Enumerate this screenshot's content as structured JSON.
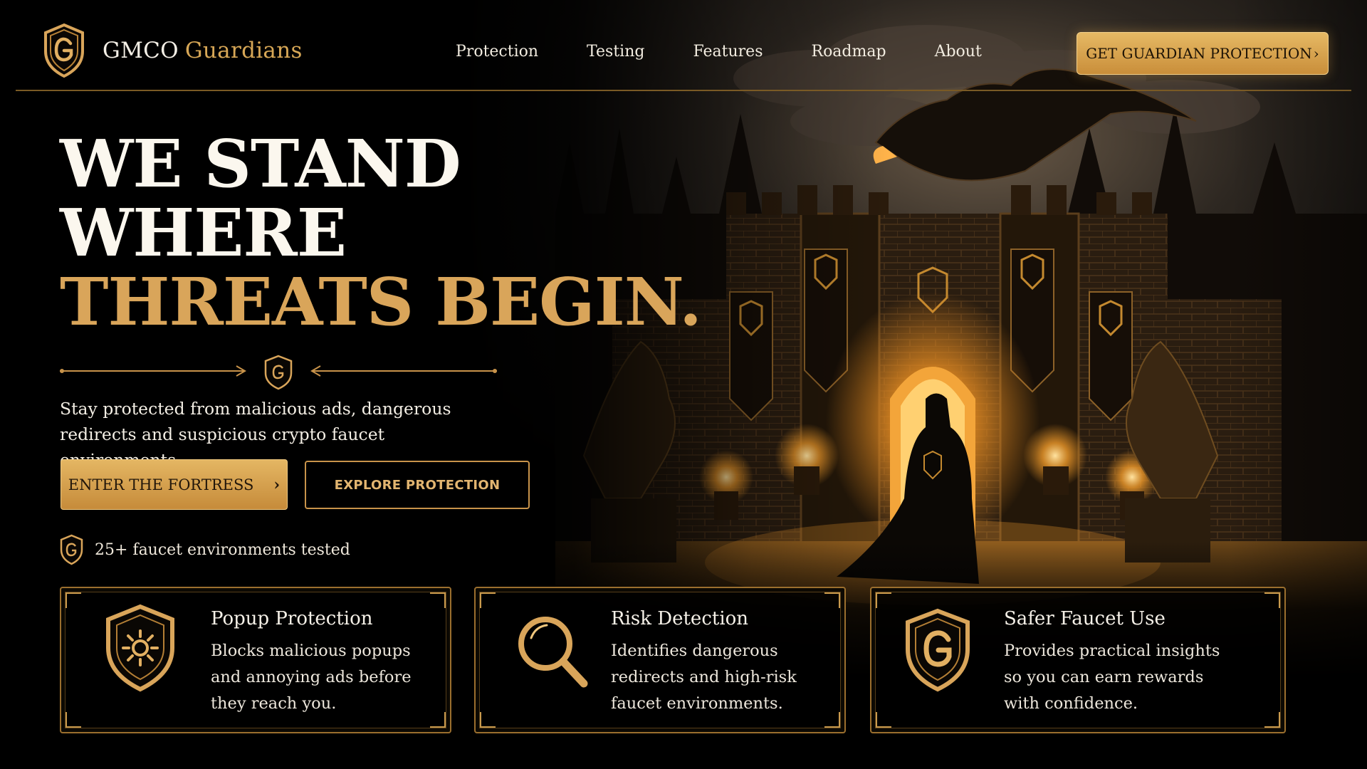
{
  "brand": {
    "name_part1": "GMCO",
    "name_part2": "Guardians",
    "accent_color": "#d7a756"
  },
  "nav": {
    "items": [
      {
        "label": "Protection"
      },
      {
        "label": "Testing"
      },
      {
        "label": "Features"
      },
      {
        "label": "Roadmap"
      },
      {
        "label": "About"
      }
    ]
  },
  "header": {
    "cta_label": "GET GUARDIAN PROTECTION",
    "cta_icon": "chevron-right-icon"
  },
  "hero": {
    "title_line1": "WE STAND",
    "title_line2": "WHERE",
    "title_line3": "THREATS BEGIN.",
    "subtitle": "Stay protected from malicious ads, dangerous redirects and suspicious crypto faucet environments.",
    "primary_button": "ENTER THE FORTRESS",
    "secondary_button": "EXPLORE PROTECTION",
    "tested_text": "25+ faucet environments tested"
  },
  "features": [
    {
      "title": "Popup Protection",
      "description_lines": [
        "Blocks malicious popups",
        "and annoying ads before",
        "they reach you."
      ],
      "icon": "shield-sun-icon"
    },
    {
      "title": "Risk Detection",
      "description_lines": [
        "Identifies dangerous",
        "redirects and high-risk",
        "faucet environments."
      ],
      "icon": "magnifier-icon"
    },
    {
      "title": "Safer Faucet Use",
      "description_lines": [
        "Provides practical insights",
        "so you can earn rewards",
        "with confidence."
      ],
      "icon": "g-shield-icon"
    }
  ],
  "colors": {
    "gold": "#d9a55a",
    "gold_dark": "#c68b3a",
    "background": "#000000"
  }
}
